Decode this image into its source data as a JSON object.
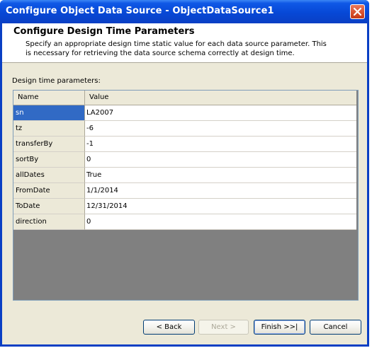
{
  "window": {
    "title": "Configure Object Data Source - ObjectDataSource1"
  },
  "header": {
    "title": "Configure Design Time Parameters",
    "description": "Specify an appropriate design time static value for each data source parameter. This is necessary for retrieving the data source schema correctly at design time."
  },
  "grid": {
    "label": "Design time parameters:",
    "columns": [
      "Name",
      "Value"
    ],
    "rows": [
      {
        "name": "sn",
        "value": "LA2007"
      },
      {
        "name": "tz",
        "value": "-6"
      },
      {
        "name": "transferBy",
        "value": "-1"
      },
      {
        "name": "sortBy",
        "value": "0"
      },
      {
        "name": "allDates",
        "value": "True"
      },
      {
        "name": "FromDate",
        "value": "1/1/2014"
      },
      {
        "name": "ToDate",
        "value": "12/31/2014"
      },
      {
        "name": "direction",
        "value": "0"
      }
    ]
  },
  "buttons": {
    "back": "< Back",
    "next": "Next >",
    "finish": "Finish >>|",
    "cancel": "Cancel"
  },
  "icons": {
    "close": "close-icon"
  },
  "colors": {
    "title_bar": "#0a3fc4",
    "selection": "#316ac5",
    "grid_empty": "#808080"
  }
}
